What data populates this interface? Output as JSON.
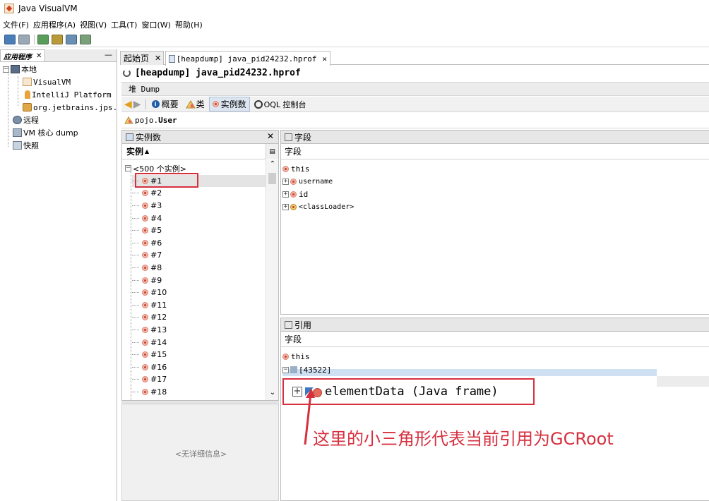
{
  "window": {
    "title": "Java VisualVM"
  },
  "menu": [
    "文件(F)",
    "应用程序(A)",
    "视图(V)",
    "工具(T)",
    "窗口(W)",
    "帮助(H)"
  ],
  "left_panel": {
    "tab_label": "应用程序",
    "tree": {
      "local": "本地",
      "visualvm": "VisualVM",
      "intellij": "IntelliJ Platform",
      "jetbrains": "org.jetbrains.jps.",
      "remote": "远程",
      "core_dump": "VM 核心 dump",
      "snapshots": "快照"
    }
  },
  "doc_tabs": [
    "起始页",
    "[heapdump] java_pid24232.hprof"
  ],
  "doc_title": "[heapdump] java_pid24232.hprof",
  "heap_label": "堆 Dump",
  "nav": {
    "summary": "概要",
    "classes": "类",
    "instances": "实例数",
    "oql": "OQL 控制台"
  },
  "class_name": {
    "package": "pojo.",
    "simple": "User"
  },
  "instances_panel": {
    "header": "实例数",
    "column": "实例",
    "sort_indicator": "▲",
    "root": "<500 个实例>",
    "items": [
      "#1",
      "#2",
      "#3",
      "#4",
      "#5",
      "#6",
      "#7",
      "#8",
      "#9",
      "#10",
      "#11",
      "#12",
      "#13",
      "#14",
      "#15",
      "#16",
      "#17",
      "#18"
    ],
    "selected": "#1"
  },
  "detail_panel": {
    "message": "<无详细信息>"
  },
  "fields_panel": {
    "header": "字段",
    "column": "字段",
    "rows": [
      "this",
      "username",
      "id",
      "<classLoader>"
    ]
  },
  "references_panel": {
    "header": "引用",
    "column": "字段",
    "this_label": "this",
    "partial_row": "[43522]",
    "highlighted": "elementData (Java frame)"
  },
  "annotation": "这里的小三角形代表当前引用为GCRoot",
  "colors": {
    "highlight_red": "#d6303f",
    "instance_dot": "#e56a5d",
    "nav_active": "#dde6f0"
  }
}
